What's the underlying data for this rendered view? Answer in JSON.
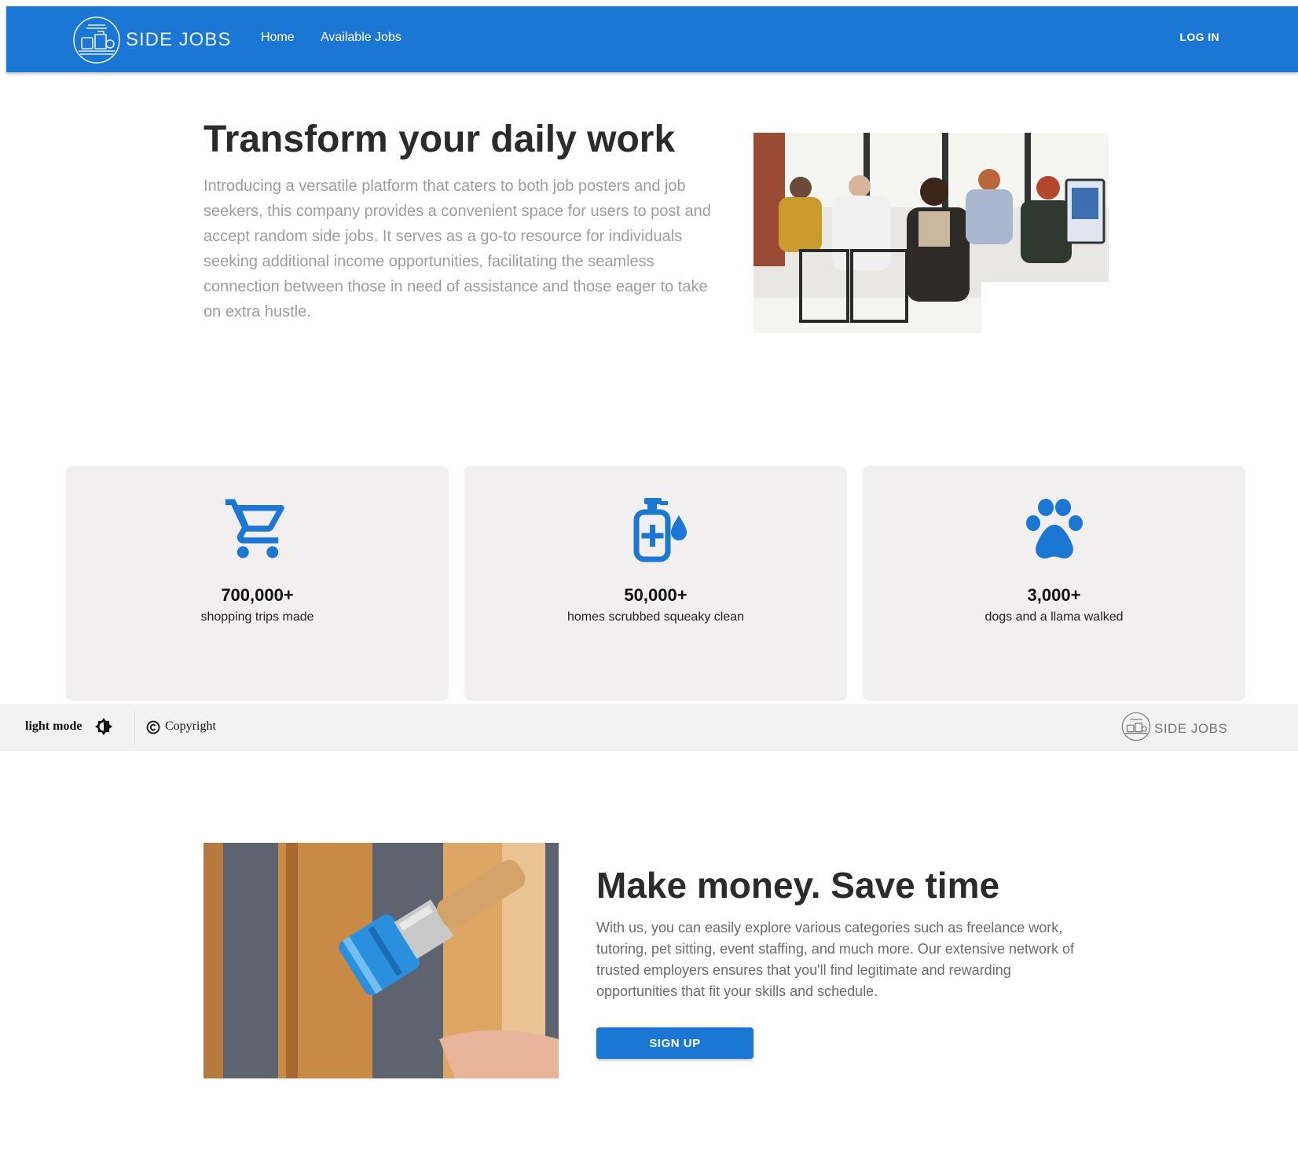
{
  "colors": {
    "primary": "#1b76d4",
    "card_bg": "#f1eff0",
    "footer_bg": "#f2f2f2"
  },
  "header": {
    "brand": "SIDE JOBS",
    "logo_icon": "side-jobs-logo",
    "nav": [
      {
        "label": "Home"
      },
      {
        "label": "Available Jobs"
      }
    ],
    "login_label": "LOG IN"
  },
  "hero": {
    "title": "Transform your daily work",
    "text": "Introducing a versatile platform that caters to both job posters and job seekers, this company provides a convenient space for users to post and accept random side jobs. It serves as a go-to resource for individuals seeking additional income opportunities, facilitating the seamless connection between those in need of assistance and those eager to take on extra hustle.",
    "image": "office-workers-photo"
  },
  "stats": [
    {
      "icon": "shopping-cart-icon",
      "value": "700,000+",
      "label": "shopping trips made"
    },
    {
      "icon": "sanitizer-icon",
      "value": "50,000+",
      "label": "homes scrubbed squeaky clean"
    },
    {
      "icon": "paw-icon",
      "value": "3,000+",
      "label": "dogs and a llama walked"
    }
  ],
  "footer": {
    "mode_label": "light mode",
    "mode_icon": "brightness-icon",
    "copyright": "Copyright",
    "brand": "SIDE JOBS"
  },
  "section2": {
    "title": "Make money. Save time",
    "text": "With us, you can easily explore various categories such as freelance work, tutoring, pet sitting, event staffing, and much more. Our extensive network of trusted employers ensures that you'll find legitimate and rewarding opportunities that fit your skills and schedule.",
    "button_label": "SIGN UP",
    "image": "paintbrush-photo"
  }
}
